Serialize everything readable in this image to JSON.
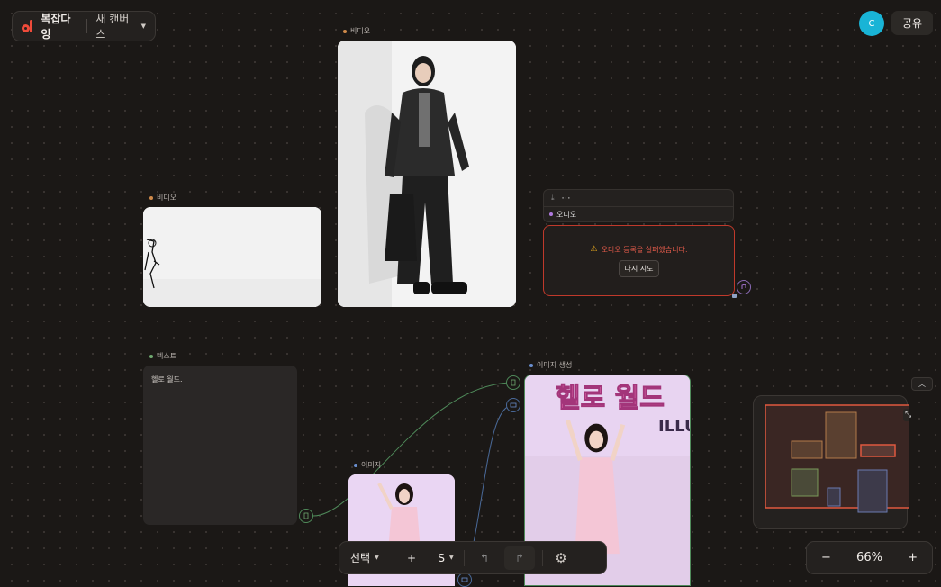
{
  "app": {
    "name": "복잡다잉",
    "canvas_name": "새 캔버스"
  },
  "header": {
    "avatar_initial": "C",
    "share_label": "공유"
  },
  "nodes": {
    "video1": {
      "label": "비디오"
    },
    "video2": {
      "label": "비디오"
    },
    "audio": {
      "label": "오디오",
      "error": "오디오 등록을 실패했습니다.",
      "retry": "다시 시도"
    },
    "text": {
      "label": "텍스트",
      "content": "헬로 월드."
    },
    "image": {
      "label": "이미지"
    },
    "image_gen": {
      "label": "이미지 생성",
      "banner_text": "헬로 월드",
      "banner_sub": "ILLU"
    }
  },
  "toolbar": {
    "select_label": "선택",
    "add_label": "+",
    "size_label": "S"
  },
  "zoom": {
    "minus": "−",
    "level": "66%",
    "plus": "+"
  },
  "colors": {
    "accent": "#ef4b3a",
    "video_dot": "#d08a4a",
    "audio_dot": "#b07ae0",
    "text_dot": "#6fa86f",
    "image_dot": "#6a8fd0",
    "error": "#c0392b"
  }
}
